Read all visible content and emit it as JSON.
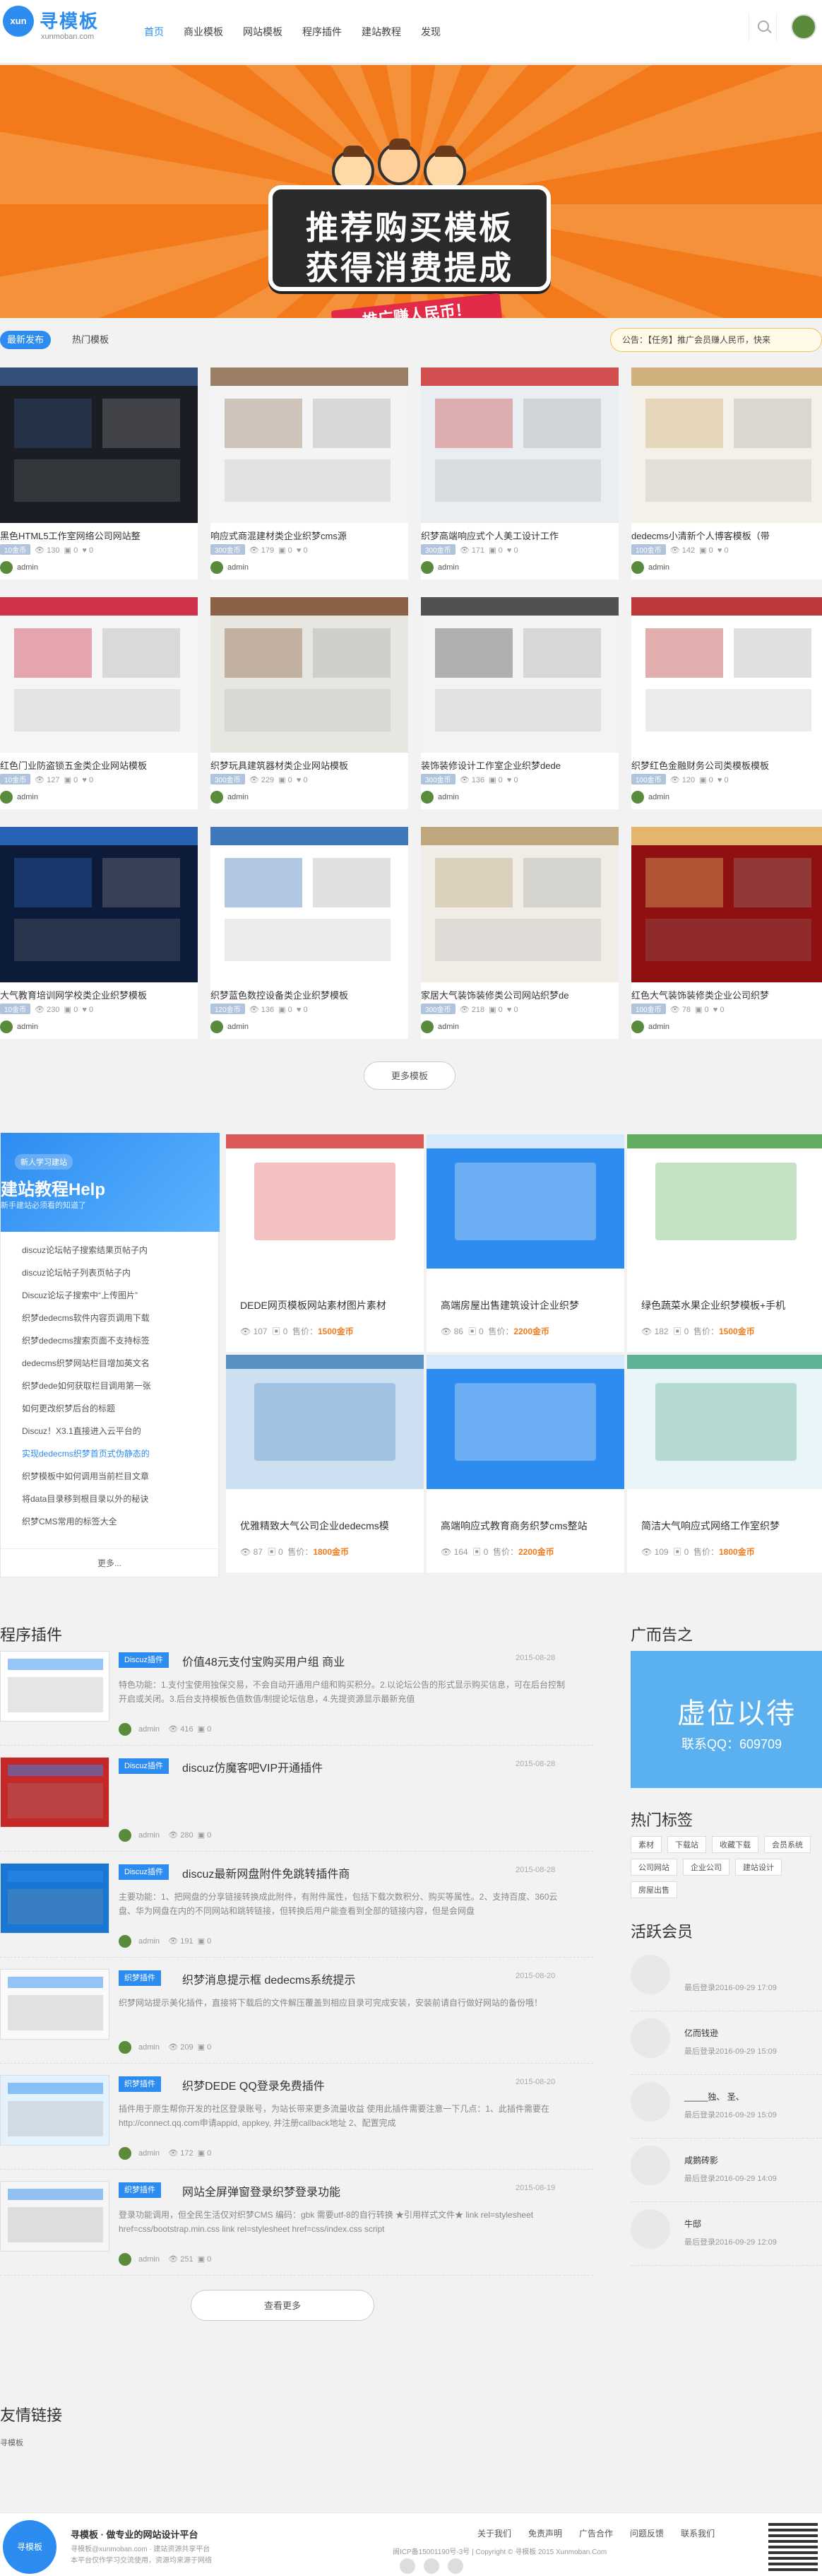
{
  "header": {
    "logo_text": "xun",
    "site_name": "寻模板",
    "site_domain": "xunmoban.com",
    "nav": [
      "首页",
      "商业模板",
      "网站模板",
      "程序插件",
      "建站教程",
      "发现"
    ]
  },
  "banner": {
    "line1": "推荐购买模板",
    "line2": "获得消费提成",
    "ribbon": "推广赚人民币！"
  },
  "tabs": {
    "latest": "最新发布",
    "hot": "热门模板",
    "notice": "公告：【任务】推广会员赚人民币，快来"
  },
  "templates": [
    {
      "title": "黑色HTML5工作室网络公司网站整",
      "price": "10金币",
      "views": "130",
      "comments": "0",
      "likes": "0",
      "author": "admin"
    },
    {
      "title": "响应式商混建材类企业织梦cms源",
      "price": "300金币",
      "views": "179",
      "comments": "0",
      "likes": "0",
      "author": "admin"
    },
    {
      "title": "织梦高端响应式个人美工设计工作",
      "price": "300金币",
      "views": "171",
      "comments": "0",
      "likes": "0",
      "author": "admin"
    },
    {
      "title": "dedecms小清新个人博客模板（带",
      "price": "100金币",
      "views": "142",
      "comments": "0",
      "likes": "0",
      "author": "admin"
    },
    {
      "title": "红色门业防盗锁五金类企业网站模板",
      "price": "10金币",
      "views": "127",
      "comments": "0",
      "likes": "0",
      "author": "admin"
    },
    {
      "title": "织梦玩具建筑器材类企业网站模板",
      "price": "300金币",
      "views": "229",
      "comments": "0",
      "likes": "0",
      "author": "admin"
    },
    {
      "title": "装饰装修设计工作室企业织梦dede",
      "price": "300金币",
      "views": "136",
      "comments": "0",
      "likes": "0",
      "author": "admin"
    },
    {
      "title": "织梦红色金融财务公司类模板模板",
      "price": "100金币",
      "views": "120",
      "comments": "0",
      "likes": "0",
      "author": "admin"
    },
    {
      "title": "大气教育培训网学校类企业织梦模板",
      "price": "10金币",
      "views": "230",
      "comments": "0",
      "likes": "0",
      "author": "admin"
    },
    {
      "title": "织梦蓝色数控设备类企业织梦模板",
      "price": "120金币",
      "views": "136",
      "comments": "0",
      "likes": "0",
      "author": "admin"
    },
    {
      "title": "家居大气装饰装修类公司网站织梦de",
      "price": "300金币",
      "views": "218",
      "comments": "0",
      "likes": "0",
      "author": "admin"
    },
    {
      "title": "红色大气装饰装修类企业公司织梦",
      "price": "100金币",
      "views": "78",
      "comments": "0",
      "likes": "0",
      "author": "admin"
    }
  ],
  "more_templates": "更多模板",
  "help": {
    "badge": "新人学习建站",
    "title": "建站教程Help",
    "subtitle": "新手建站必须看的知道了",
    "items": [
      "discuz论坛帖子搜索结果页帖子内",
      "discuz论坛帖子列表页帖子内",
      "Discuz论坛子搜索中“上传图片”",
      "织梦dedecms软件内容页调用下载",
      "织梦dedecms搜索页面不支持标签",
      "dedecms织梦网站栏目增加英文名",
      "织梦dede如何获取栏目调用第一张",
      "如何更改织梦后台的标题",
      "Discuz！X3.1直接进入云平台的",
      "实现dedecms织梦首页式伪静态的",
      "织梦模板中如何调用当前栏目文章",
      "将data目录移到根目录以外的秘诀",
      "织梦CMS常用的标签大全"
    ],
    "more": "更多..."
  },
  "premium": [
    {
      "title": "DEDE网页模板网站素材图片素材",
      "views": "107",
      "comments": "0",
      "price_label": "售价：",
      "price": "1500金币"
    },
    {
      "title": "高端房屋出售建筑设计企业织梦",
      "views": "86",
      "comments": "0",
      "price_label": "售价：",
      "price": "2200金币"
    },
    {
      "title": "绿色蔬菜水果企业织梦模板+手机",
      "views": "182",
      "comments": "0",
      "price_label": "售价：",
      "price": "1500金币"
    },
    {
      "title": "优雅精致大气公司企业dedecms模",
      "views": "87",
      "comments": "0",
      "price_label": "售价：",
      "price": "1800金币"
    },
    {
      "title": "高端响应式教育商务织梦cms整站",
      "views": "164",
      "comments": "0",
      "price_label": "售价：",
      "price": "2200金币"
    },
    {
      "title": "简洁大气响应式网络工作室织梦",
      "views": "109",
      "comments": "0",
      "price_label": "售价：",
      "price": "1800金币"
    }
  ],
  "plugins_heading": "程序插件",
  "plugins": [
    {
      "tag": "Discuz插件",
      "title": "价值48元支付宝购买用户组 商业",
      "date": "2015-08-28",
      "desc": "特色功能：1.支付宝使用独保交易，不会自动开通用户组和购买积分。2.以论坛公告的形式显示购买信息，可在后台控制开启或关闭。3.后台支持模板色值数值/制提论坛信息，4.先提资源显示最新充值",
      "views": "416",
      "comments": "0",
      "author": "admin"
    },
    {
      "tag": "Discuz插件",
      "title": "discuz仿魔客吧VIP开通插件",
      "date": "2015-08-28",
      "desc": "",
      "views": "280",
      "comments": "0",
      "author": "admin"
    },
    {
      "tag": "Discuz插件",
      "title": "discuz最新网盘附件免跳转插件商",
      "date": "2015-08-28",
      "desc": "主要功能：1、把网盘的分享链接转换成此附件，有附件属性，包括下载次数积分、购买等属性。2、支持百度、360云盘、华为网盘在内的不同网站和跳转链接，但转换后用户能查看到全部的链接内容，但是会网盘",
      "views": "191",
      "comments": "0",
      "author": "admin"
    },
    {
      "tag": "织梦插件",
      "title": "织梦消息提示框 dedecms系统提示",
      "date": "2015-08-20",
      "desc": "织梦网站提示美化插件，直接将下载后的文件解压覆盖到相应目录可完成安装，安装前请自行做好网站的备份哦！",
      "views": "209",
      "comments": "0",
      "author": "admin"
    },
    {
      "tag": "织梦插件",
      "title": "织梦DEDE QQ登录免费插件",
      "date": "2015-08-20",
      "desc": "插件用于原生帮你开发的社区登录账号，为站长带来更多流量收益 使用此插件需要注意一下几点：1、此插件需要在http://connect.qq.com申请appid, appkey, 并注册callback地址 2、配置完成",
      "views": "172",
      "comments": "0",
      "author": "admin"
    },
    {
      "tag": "织梦插件",
      "title": "网站全屏弹窗登录织梦登录功能",
      "date": "2015-08-19",
      "desc": "登录功能调用，但全民生活仅对织梦CMS 编码：gbk 需要utf-8的自行转换 ★引用样式文件★ link rel=stylesheet href=css/bootstrap.min.css link rel=stylesheet href=css/index.css script",
      "views": "251",
      "comments": "0",
      "author": "admin"
    }
  ],
  "more_plugins": "查看更多",
  "sidebar": {
    "ad_heading": "广而告之",
    "ad_line1": "虚位以待",
    "ad_line2": "联系QQ：609709",
    "tags_heading": "热门标签",
    "tags": [
      "素材",
      "下载站",
      "收藏下载",
      "会员系统",
      "公司网站",
      "企业公司",
      "建站设计",
      "房屋出售"
    ],
    "members_heading": "活跃会员",
    "members": [
      {
        "name": "",
        "time": "最后登录2016-09-29 17:09"
      },
      {
        "name": "亿而钱逊",
        "time": "最后登录2016-09-29 15:09"
      },
      {
        "name": "_____独、 圣、",
        "time": "最后登录2016-09-29 15:09"
      },
      {
        "name": "咸鹅砖影",
        "time": "最后登录2016-09-29 14:09"
      },
      {
        "name": "牛邸",
        "time": "最后登录2016-09-29 12:09"
      }
    ]
  },
  "links": {
    "heading": "友情链接",
    "item": "寻模板"
  },
  "footer": {
    "logo": "寻模板",
    "title": "寻模板 · 做专业的网站设计平台",
    "line1": "寻模板@xunmoban.com · 建站资源共享平台",
    "line2": "本平台仅作学习交流使用，资源均来源于网络",
    "links": [
      "关于我们",
      "免责声明",
      "广告合作",
      "问题反馈",
      "联系我们"
    ],
    "copyright": "闽ICP备15001190号-3号 | Copyright © 寻模板 2015 Xunmoban.Com"
  }
}
